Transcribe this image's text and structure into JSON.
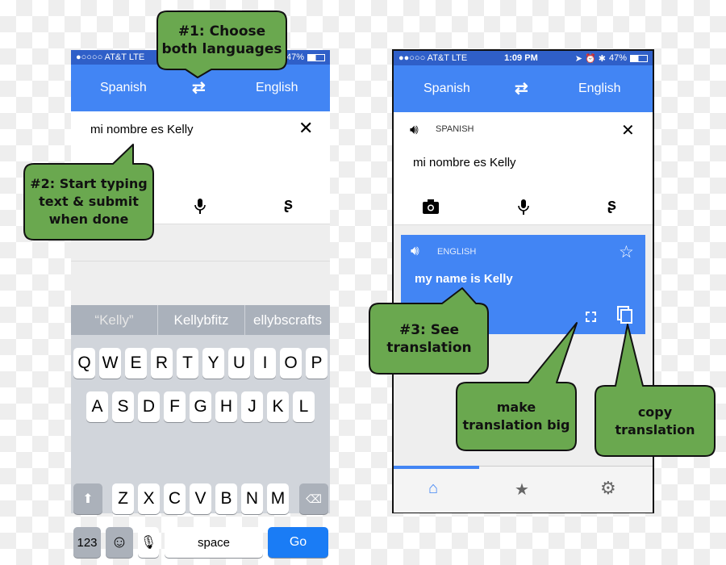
{
  "colors": {
    "header": "#4285f4",
    "status": "#2f5fc8",
    "callout": "#6aa84f",
    "go": "#1a7cf5"
  },
  "left_phone": {
    "status": {
      "signal": "●○○○○ AT&T  LTE",
      "battery": "47%"
    },
    "header": {
      "source_lang": "Spanish",
      "target_lang": "English",
      "swap_icon": "swap-icon"
    },
    "input": {
      "text": "mi nombre es Kelly"
    },
    "suggestions": [
      "“Kelly”",
      "Kellybfitz",
      "ellybscrafts"
    ],
    "keyboard": {
      "row1": [
        "Q",
        "W",
        "E",
        "R",
        "T",
        "Y",
        "U",
        "I",
        "O",
        "P"
      ],
      "row2": [
        "A",
        "S",
        "D",
        "F",
        "G",
        "H",
        "J",
        "K",
        "L"
      ],
      "row3": [
        "Z",
        "X",
        "C",
        "V",
        "B",
        "N",
        "M"
      ],
      "numbers": "123",
      "space": "space",
      "go": "Go"
    }
  },
  "right_phone": {
    "status": {
      "signal": "●●○○○ AT&T  LTE",
      "time": "1:09 PM",
      "battery": "47%"
    },
    "header": {
      "source_lang": "Spanish",
      "target_lang": "English"
    },
    "source_card": {
      "lang_label": "SPANISH",
      "text": "mi nombre es Kelly"
    },
    "result_card": {
      "lang_label": "ENGLISH",
      "text": "my name is Kelly"
    },
    "bottom_nav": [
      "home-icon",
      "star-icon",
      "gear-icon"
    ],
    "progress": 0.33
  },
  "callouts": {
    "c1": "#1: Choose both languages",
    "c2": "#2: Start typing text & submit when done",
    "c3": "#3: See translation",
    "c4": "make translation big",
    "c5": "copy translation"
  }
}
